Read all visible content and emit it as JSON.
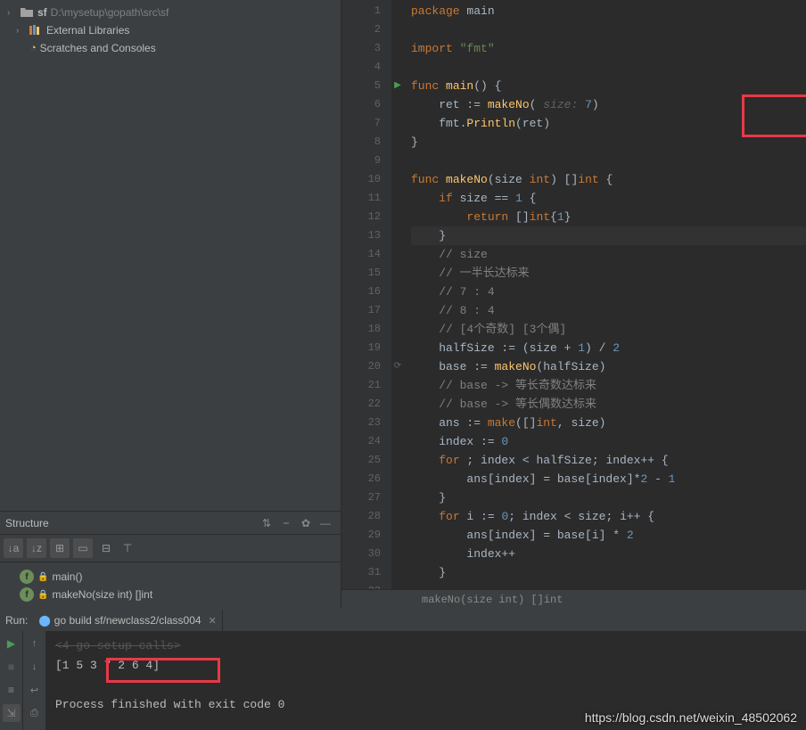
{
  "project": {
    "root_name": "sf",
    "root_path": "D:\\mysetup\\gopath\\src\\sf",
    "external_libs": "External Libraries",
    "scratches": "Scratches and Consoles"
  },
  "structure": {
    "title": "Structure",
    "items": [
      {
        "label": "main()"
      },
      {
        "label": "makeNo(size int) []int"
      }
    ]
  },
  "editor": {
    "gutter_start": 1,
    "gutter_lines": 32,
    "play_line": 5,
    "recurse_line": 20,
    "caret_line": 13,
    "breadcrumb": "makeNo(size int) []int",
    "code": [
      [
        [
          "k",
          "package"
        ],
        [
          "t",
          " main"
        ]
      ],
      [],
      [
        [
          "k",
          "import"
        ],
        [
          "t",
          " "
        ],
        [
          "s",
          "\"fmt\""
        ]
      ],
      [],
      [
        [
          "k",
          "func"
        ],
        [
          "t",
          " "
        ],
        [
          "fn",
          "main"
        ],
        [
          "t",
          "() {"
        ]
      ],
      [
        [
          "t",
          "    ret := "
        ],
        [
          "fn",
          "makeNo"
        ],
        [
          "t",
          "( "
        ],
        [
          "hint",
          "size:"
        ],
        [
          "t",
          " "
        ],
        [
          "n",
          "7"
        ],
        [
          "t",
          ")"
        ]
      ],
      [
        [
          "t",
          "    fmt."
        ],
        [
          "fn",
          "Println"
        ],
        [
          "t",
          "(ret)"
        ]
      ],
      [
        [
          "t",
          "}"
        ]
      ],
      [],
      [
        [
          "k",
          "func"
        ],
        [
          "t",
          " "
        ],
        [
          "fn",
          "makeNo"
        ],
        [
          "t",
          "(size "
        ],
        [
          "k",
          "int"
        ],
        [
          "t",
          ") []"
        ],
        [
          "k",
          "int"
        ],
        [
          "t",
          " {"
        ]
      ],
      [
        [
          "t",
          "    "
        ],
        [
          "k",
          "if"
        ],
        [
          "t",
          " size == "
        ],
        [
          "n",
          "1"
        ],
        [
          "t",
          " {"
        ]
      ],
      [
        [
          "t",
          "        "
        ],
        [
          "k",
          "return"
        ],
        [
          "t",
          " []"
        ],
        [
          "k",
          "int"
        ],
        [
          "t",
          "{"
        ],
        [
          "n",
          "1"
        ],
        [
          "t",
          "}"
        ]
      ],
      [
        [
          "t",
          "    }"
        ]
      ],
      [
        [
          "t",
          "    "
        ],
        [
          "c",
          "// size"
        ]
      ],
      [
        [
          "t",
          "    "
        ],
        [
          "c",
          "// 一半长达标来"
        ]
      ],
      [
        [
          "t",
          "    "
        ],
        [
          "c",
          "// 7 : 4"
        ]
      ],
      [
        [
          "t",
          "    "
        ],
        [
          "c",
          "// 8 : 4"
        ]
      ],
      [
        [
          "t",
          "    "
        ],
        [
          "c",
          "// [4个奇数] [3个偶]"
        ]
      ],
      [
        [
          "t",
          "    halfSize := (size + "
        ],
        [
          "n",
          "1"
        ],
        [
          "t",
          ") / "
        ],
        [
          "n",
          "2"
        ]
      ],
      [
        [
          "t",
          "    base := "
        ],
        [
          "fn",
          "makeNo"
        ],
        [
          "t",
          "(halfSize)"
        ]
      ],
      [
        [
          "t",
          "    "
        ],
        [
          "c",
          "// base -> 等长奇数达标来"
        ]
      ],
      [
        [
          "t",
          "    "
        ],
        [
          "c",
          "// base -> 等长偶数达标来"
        ]
      ],
      [
        [
          "t",
          "    ans := "
        ],
        [
          "k",
          "make"
        ],
        [
          "t",
          "([]"
        ],
        [
          "k",
          "int"
        ],
        [
          "t",
          ", size)"
        ]
      ],
      [
        [
          "t",
          "    index := "
        ],
        [
          "n",
          "0"
        ]
      ],
      [
        [
          "t",
          "    "
        ],
        [
          "k",
          "for"
        ],
        [
          "t",
          " ; index < halfSize; index++ {"
        ]
      ],
      [
        [
          "t",
          "        ans[index] = base[index]*"
        ],
        [
          "n",
          "2"
        ],
        [
          "t",
          " - "
        ],
        [
          "n",
          "1"
        ]
      ],
      [
        [
          "t",
          "    }"
        ]
      ],
      [
        [
          "t",
          "    "
        ],
        [
          "k",
          "for"
        ],
        [
          "t",
          " i := "
        ],
        [
          "n",
          "0"
        ],
        [
          "t",
          "; index < size; i++ {"
        ]
      ],
      [
        [
          "t",
          "        ans[index] = base[i] * "
        ],
        [
          "n",
          "2"
        ]
      ],
      [
        [
          "t",
          "        index++"
        ]
      ],
      [
        [
          "t",
          "    }"
        ]
      ],
      []
    ]
  },
  "run": {
    "label": "Run:",
    "tab": "go build sf/newclass2/class004",
    "setup_line": "<4 go setup calls>",
    "output": "[1 5 3 7 2 6 4]",
    "finished": "Process finished with exit code 0"
  },
  "watermark": "https://blog.csdn.net/weixin_48502062"
}
